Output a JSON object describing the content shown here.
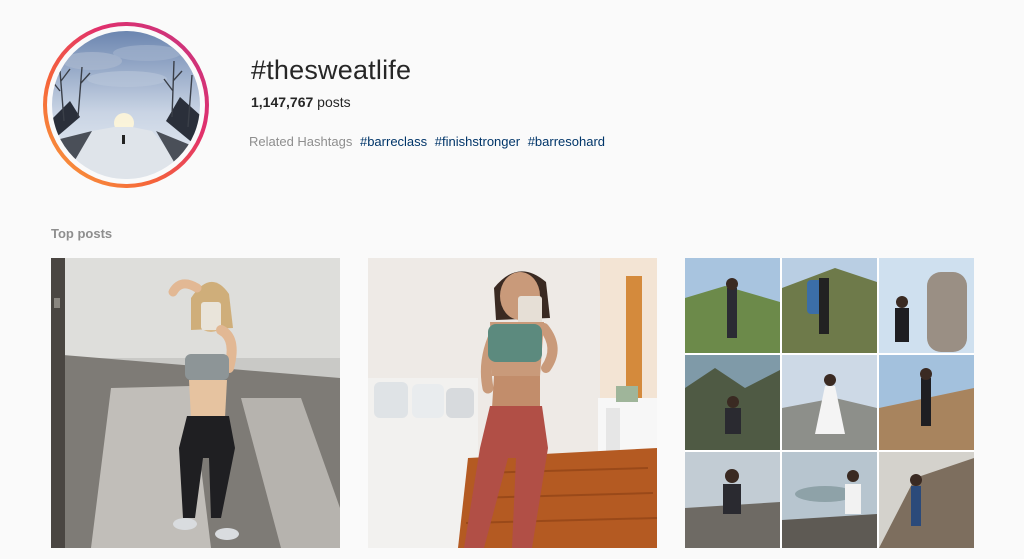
{
  "header": {
    "hashtag": "#thesweatlife",
    "post_count": "1,147,767",
    "post_count_suffix": " posts",
    "related_label": "Related Hashtags",
    "related_tags": [
      "#barreclass",
      "#finishstronger",
      "#barresohard"
    ]
  },
  "top_posts": {
    "label": "Top posts",
    "posts": [
      {
        "kind": "photo",
        "subject": "mirror-selfie-sports-bra-leggings"
      },
      {
        "kind": "photo",
        "subject": "mirror-selfie-red-leggings"
      },
      {
        "kind": "photo-grid",
        "subject": "hiking-collage"
      }
    ]
  },
  "colors": {
    "ring_start": "#f9a43a",
    "ring_end": "#c13584",
    "link": "#003569",
    "muted": "#8e8e8e",
    "text": "#262626"
  }
}
